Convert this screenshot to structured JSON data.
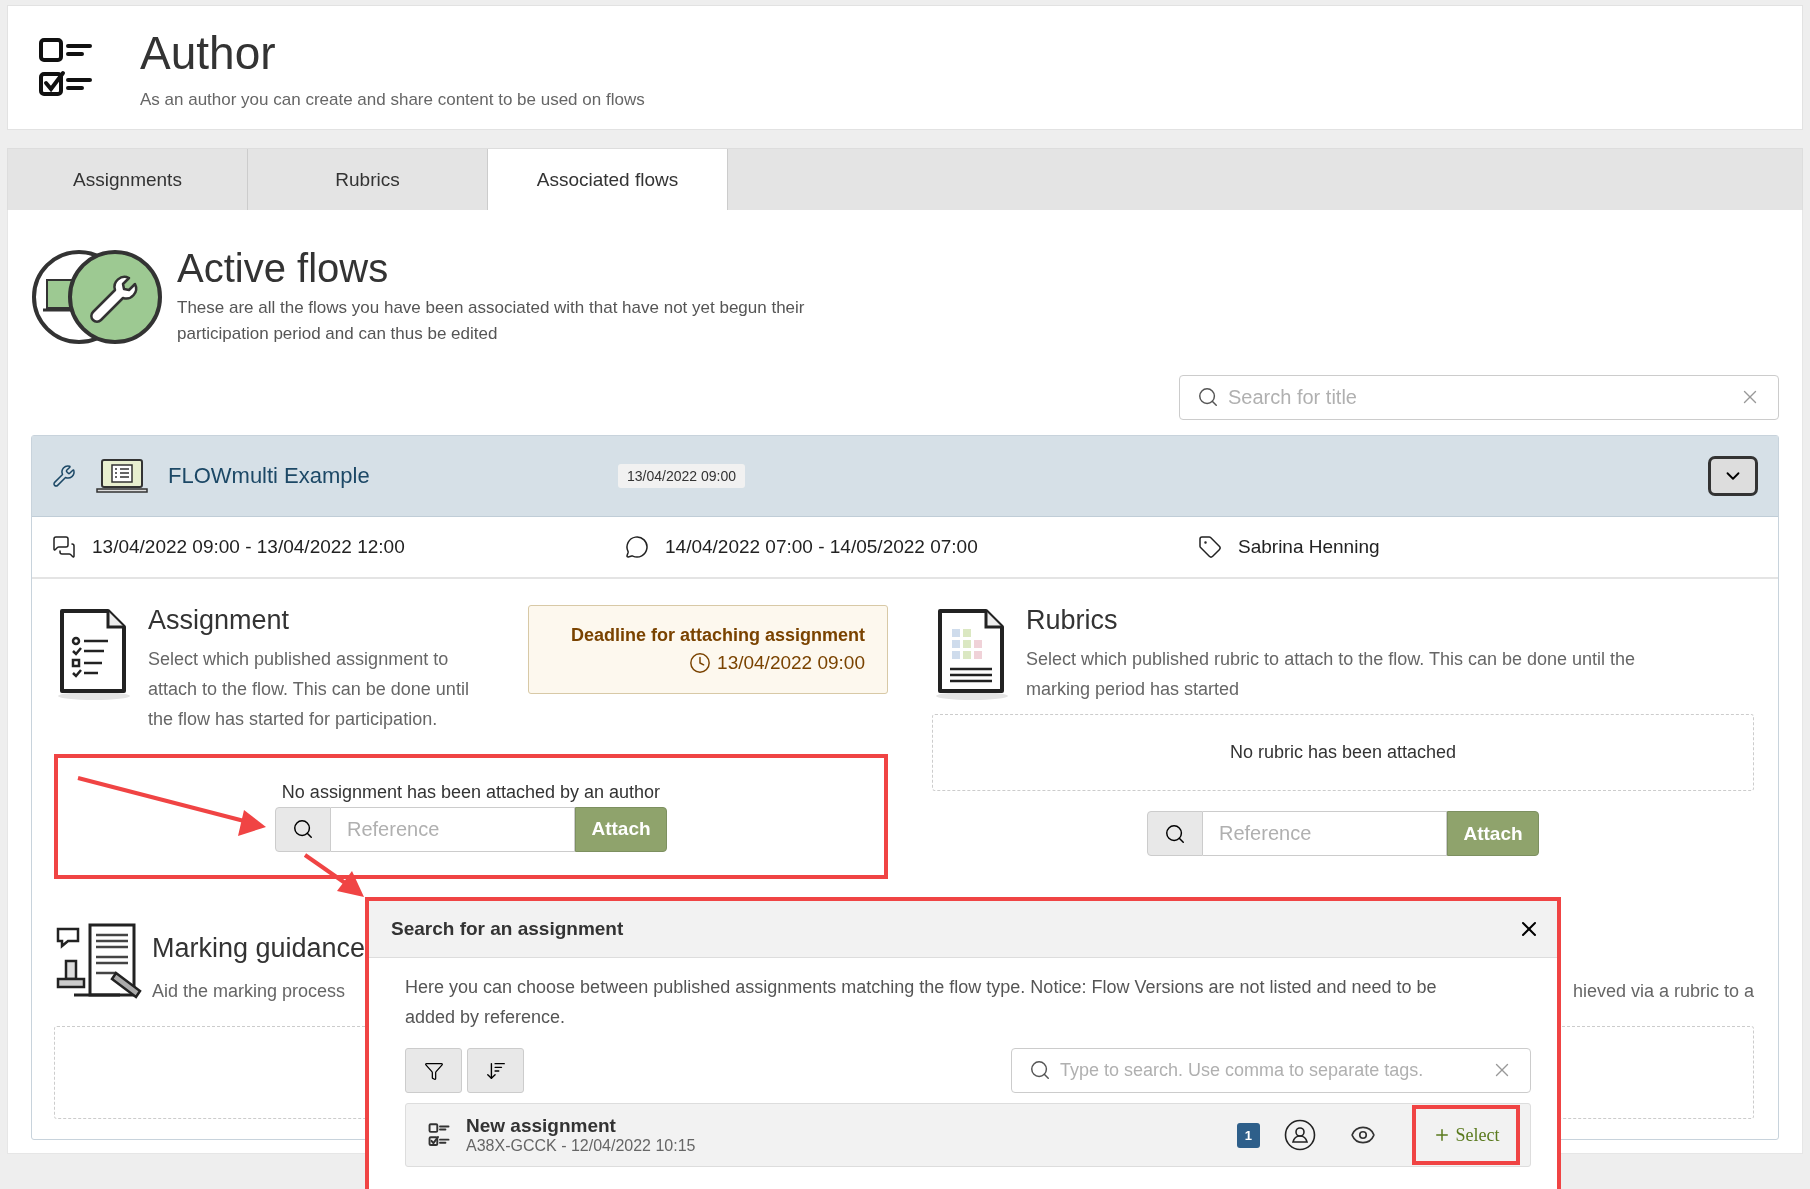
{
  "header": {
    "title": "Author",
    "subtitle": "As an author you can create and share content to be used on flows"
  },
  "tabs": [
    {
      "label": "Assignments",
      "selected": false
    },
    {
      "label": "Rubrics",
      "selected": false
    },
    {
      "label": "Associated flows",
      "selected": true
    }
  ],
  "section": {
    "title": "Active flows",
    "description": "These are all the flows you have been associated with that have not yet begun their participation period and can thus be edited"
  },
  "search": {
    "placeholder": "Search for title"
  },
  "flow": {
    "title": "FLOWmulti Example",
    "date_badge": "13/04/2022 09:00",
    "info": [
      {
        "kind": "participation",
        "text": "13/04/2022 09:00 - 13/04/2022 12:00"
      },
      {
        "kind": "marking",
        "text": "14/04/2022 07:00 - 14/05/2022 07:00"
      },
      {
        "kind": "author",
        "text": "Sabrina Henning"
      }
    ]
  },
  "assignment": {
    "title": "Assignment",
    "description": "Select which published assignment to attach to the flow. This can be done until the flow has started for participation.",
    "deadline_label": "Deadline for attaching assignment",
    "deadline_date": "13/04/2022 09:00",
    "empty_text": "No assignment has been attached by an author",
    "reference_placeholder": "Reference",
    "attach_label": "Attach"
  },
  "rubrics": {
    "title": "Rubrics",
    "description": "Select which published rubric to attach to the flow. This can be done until the marking period has started",
    "empty_text": "No rubric has been attached",
    "reference_placeholder": "Reference",
    "attach_label": "Attach"
  },
  "marking_guidance": {
    "title": "Marking guidance",
    "description": "Aid the marking process",
    "description_tail": "hieved via a rubric to a"
  },
  "dialog": {
    "title": "Search for an assignment",
    "description": "Here you can choose between published assignments matching the flow type. Notice: Flow Versions are not listed and need to be added by reference.",
    "search_placeholder": "Type to search. Use comma to separate tags.",
    "items": [
      {
        "title": "New assignment",
        "subtitle": "A38X-GCCK - 12/04/2022 10:15",
        "badge": "1",
        "action": "Select"
      }
    ]
  }
}
